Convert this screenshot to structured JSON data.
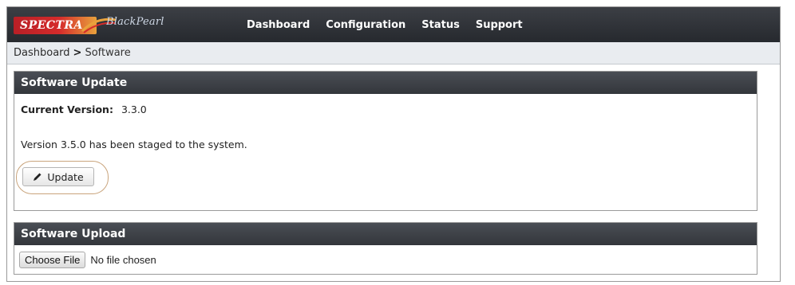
{
  "brand": {
    "name": "SPECTRA",
    "product": "BlackPearl"
  },
  "nav": {
    "items": [
      "Dashboard",
      "Configuration",
      "Status",
      "Support"
    ]
  },
  "breadcrumb": {
    "parent": "Dashboard",
    "separator": ">",
    "current": "Software"
  },
  "software_update": {
    "title": "Software Update",
    "current_version_label": "Current Version:",
    "current_version_value": "3.3.0",
    "staged_message": "Version 3.5.0 has been staged to the system.",
    "update_button_label": "Update",
    "update_icon": "pencil-icon"
  },
  "software_upload": {
    "title": "Software Upload",
    "choose_file_label": "Choose File",
    "file_status": "No file chosen"
  },
  "colors": {
    "topbar": "#2b2e33",
    "panel_header": "#3c3f45",
    "brand_red": "#d52b2b",
    "highlight_ring": "#c9a47c"
  }
}
